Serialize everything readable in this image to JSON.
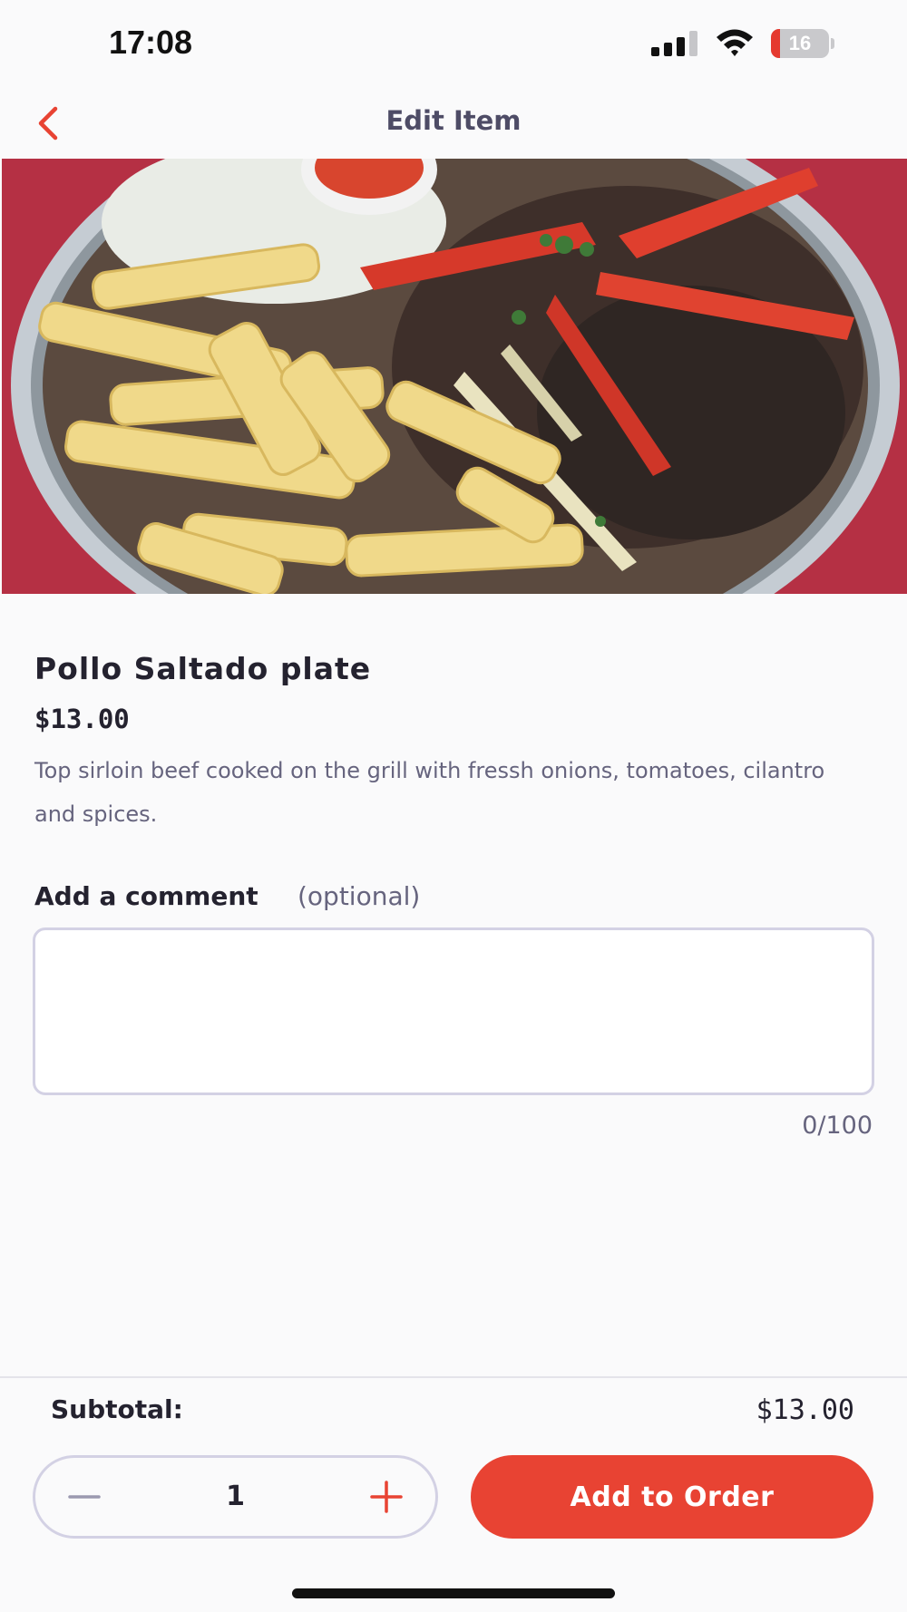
{
  "status_bar": {
    "time": "17:08",
    "battery_level": "16",
    "battery_fraction": 0.16,
    "icons": [
      "signal-icon",
      "wifi-icon",
      "battery-icon"
    ]
  },
  "nav": {
    "title": "Edit Item",
    "back_icon": "chevron-left-icon"
  },
  "colors": {
    "accent": "#e84333",
    "text_primary": "#24222f",
    "text_secondary": "#66647e",
    "border": "#d3d1e4"
  },
  "item": {
    "name": "Pollo Saltado plate",
    "price": "$13.00",
    "description": "Top sirloin beef cooked on the grill with fressh onions, tomatoes, cilantro and spices."
  },
  "comment": {
    "label": "Add a comment",
    "optional": "(optional)",
    "value": "",
    "counter": "0/100"
  },
  "footer": {
    "subtotal_label": "Subtotal:",
    "subtotal_value": "$13.00",
    "quantity": "1",
    "minus_icon": "minus-icon",
    "plus_icon": "plus-icon",
    "add_button_label": "Add to Order"
  }
}
